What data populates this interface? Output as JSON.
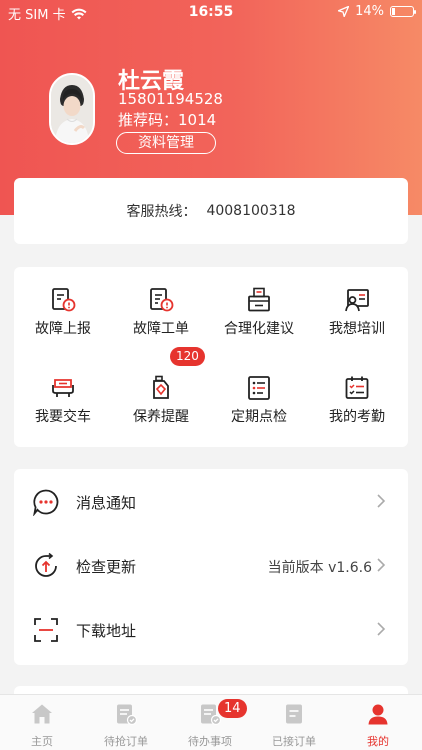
{
  "status_bar": {
    "carrier": "无 SIM 卡",
    "time": "16:55",
    "battery": "14%",
    "battery_level": 0.14
  },
  "profile": {
    "name": "杜云霞",
    "phone": "15801194528",
    "ref_code": "推荐码：1014",
    "manage_button": "资料管理"
  },
  "hotline": {
    "label": "客服热线：",
    "number": "4008100318"
  },
  "grid": [
    {
      "label": "故障上报",
      "icon": "fault-report-icon"
    },
    {
      "label": "故障工单",
      "icon": "fault-order-icon"
    },
    {
      "label": "合理化建议",
      "icon": "suggestion-box-icon"
    },
    {
      "label": "我想培训",
      "icon": "training-icon"
    },
    {
      "label": "我要交车",
      "icon": "vehicle-return-icon"
    },
    {
      "label": "保养提醒",
      "icon": "maintenance-bottle-icon",
      "badge": "120"
    },
    {
      "label": "定期点检",
      "icon": "checklist-icon"
    },
    {
      "label": "我的考勤",
      "icon": "attendance-calendar-icon"
    }
  ],
  "menu": [
    {
      "label": "消息通知",
      "icon": "message-bubble-icon",
      "right": ""
    },
    {
      "label": "检查更新",
      "icon": "update-arrow-icon",
      "right": "当前版本 v1.6.6"
    },
    {
      "label": "下载地址",
      "icon": "scan-frame-icon",
      "right": ""
    }
  ],
  "tabs": [
    {
      "label": "主页",
      "icon": "home-icon"
    },
    {
      "label": "待抢订单",
      "icon": "grab-order-icon"
    },
    {
      "label": "待办事项",
      "icon": "todo-icon",
      "badge": "14"
    },
    {
      "label": "已接订单",
      "icon": "accepted-order-icon"
    },
    {
      "label": "我的",
      "icon": "profile-icon",
      "active": true
    }
  ],
  "colors": {
    "accent": "#e6342e",
    "header_start": "#ef5552",
    "header_end": "#f68a66"
  }
}
